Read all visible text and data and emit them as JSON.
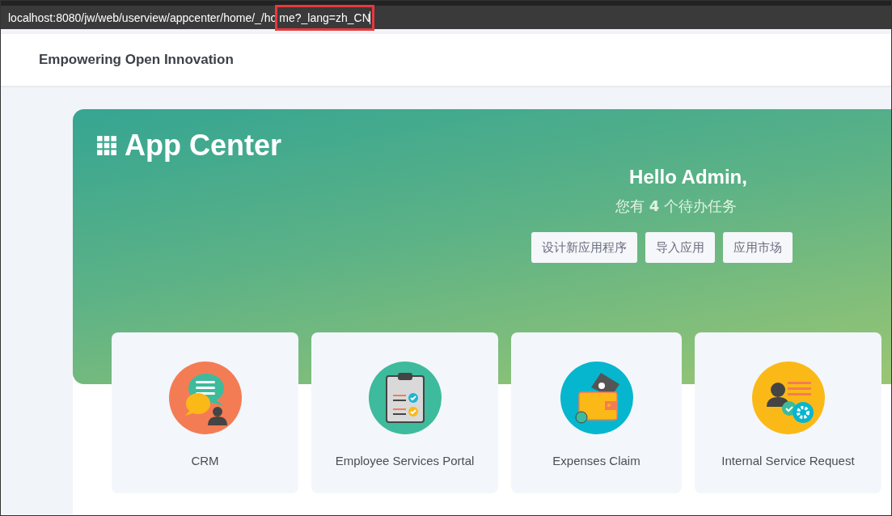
{
  "address_bar": {
    "text": "localhost:8080/jw/web/userview/appcenter/home/_/ho",
    "highlighted_text": "me?_lang=zh_CN"
  },
  "header": {
    "title": "Empowering Open Innovation"
  },
  "banner": {
    "title": "App Center",
    "greeting": "Hello Admin,",
    "tasks_prefix": "您有",
    "tasks_count": "4",
    "tasks_suffix": "个待办任务",
    "buttons": [
      "设计新应用程序",
      "导入应用",
      "应用市场"
    ]
  },
  "apps": [
    {
      "name": "CRM",
      "kind": "chat"
    },
    {
      "name": "Employee Services Portal",
      "kind": "clipboard"
    },
    {
      "name": "Expenses Claim",
      "kind": "wallet"
    },
    {
      "name": "Internal Service Request",
      "kind": "service"
    }
  ]
}
